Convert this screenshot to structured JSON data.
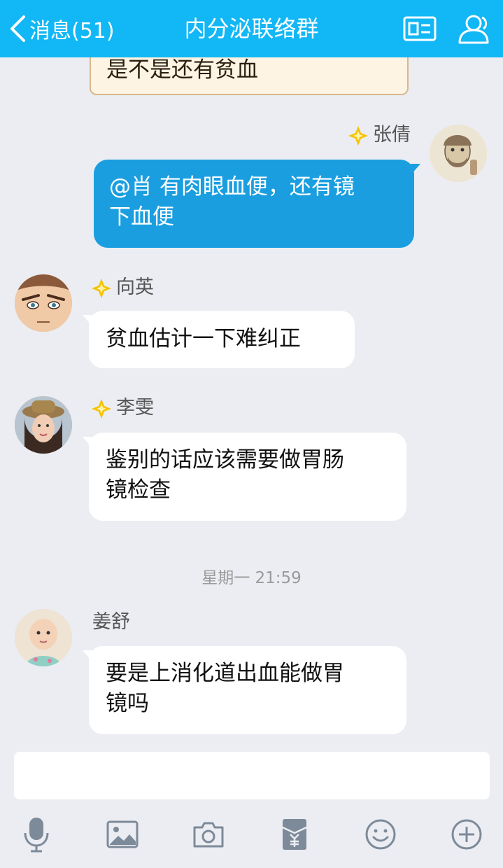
{
  "header": {
    "back_label": "消息(51)",
    "title": "内分泌联络群"
  },
  "messages": {
    "partial_card": {
      "text": "是不是还有贫血"
    },
    "m1": {
      "sender": "张倩",
      "text_line1": "@肖 有肉眼血便，还有镜",
      "text_line2": "下血便"
    },
    "m2": {
      "sender": "向英",
      "text_line1": "贫血估计一下难纠正"
    },
    "m3": {
      "sender": "李雯",
      "text_line1": "鉴别的话应该需要做胃肠",
      "text_line2": "镜检查"
    },
    "timestamp": "星期一 21:59",
    "m4": {
      "sender": "姜舒",
      "text_line1": "要是上消化道出血能做胃",
      "text_line2": "镜吗"
    }
  },
  "input": {
    "value": "",
    "placeholder": ""
  },
  "colors": {
    "header": "#12b7f5",
    "outgoing_bubble": "#1a9ee0",
    "background": "#ebedf2",
    "badge": "#f6c200"
  },
  "icons": [
    "chevron-left-icon",
    "profile-card-icon",
    "group-members-icon",
    "microphone-icon",
    "image-icon",
    "camera-icon",
    "red-envelope-icon",
    "emoji-icon",
    "plus-icon",
    "diamond-badge-icon"
  ]
}
